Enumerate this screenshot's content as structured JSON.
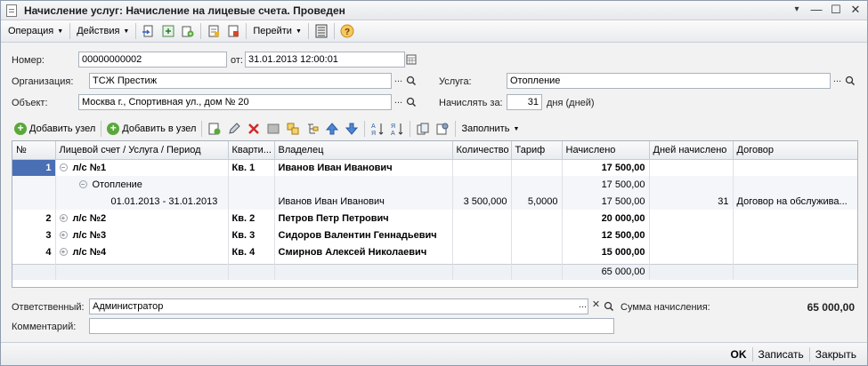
{
  "window": {
    "title": "Начисление услуг: Начисление на лицевые счета. Проведен",
    "menu_glyph": "▾",
    "min_glyph": "—",
    "max_glyph": "☐",
    "close_glyph": "✕"
  },
  "commandbar": {
    "operation": "Операция",
    "actions": "Действия",
    "goto": "Перейти"
  },
  "form": {
    "number_label": "Номер:",
    "number_value": "00000000002",
    "from_label": "от:",
    "date_value": "31.01.2013 12:00:01",
    "org_label": "Организация:",
    "org_value": "ТСЖ Престиж",
    "object_label": "Объект:",
    "object_value": "Москва г., Спортивная ул., дом № 20",
    "service_label": "Услуга:",
    "service_value": "Отопление",
    "accrue_label": "Начислять за:",
    "accrue_days": "31",
    "accrue_unit": "дня (дней)",
    "ellipsis": "...",
    "clear": "✕"
  },
  "table_toolbar": {
    "add_node": "Добавить узел",
    "add_in_node": "Добавить в узел",
    "fill": "Заполнить"
  },
  "grid": {
    "columns": [
      "№",
      "Лицевой счет / Услуга / Период",
      "Кварти...",
      "Владелец",
      "Количество",
      "Тариф",
      "Начислено",
      "Дней начислено",
      "Договор"
    ],
    "rows": [
      {
        "n": "1",
        "account": "л/с №1",
        "apt": "Кв. 1",
        "owner": "Иванов Иван Иванович",
        "qty": "",
        "tariff": "",
        "accrued": "17 500,00",
        "days": "",
        "contract": ""
      },
      {
        "n": "",
        "account": "Отопление",
        "apt": "",
        "owner": "",
        "qty": "",
        "tariff": "",
        "accrued": "17 500,00",
        "days": "",
        "contract": ""
      },
      {
        "n": "",
        "account": "01.01.2013 - 31.01.2013",
        "apt": "",
        "owner": "Иванов Иван Иванович",
        "qty": "3 500,000",
        "tariff": "5,0000",
        "accrued": "17 500,00",
        "days": "31",
        "contract": "Договор на обслужива..."
      },
      {
        "n": "2",
        "account": "л/с №2",
        "apt": "Кв. 2",
        "owner": "Петров Петр Петрович",
        "qty": "",
        "tariff": "",
        "accrued": "20 000,00",
        "days": "",
        "contract": ""
      },
      {
        "n": "3",
        "account": "л/с №3",
        "apt": "Кв. 3",
        "owner": "Сидоров Валентин Геннадьевич",
        "qty": "",
        "tariff": "",
        "accrued": "12 500,00",
        "days": "",
        "contract": ""
      },
      {
        "n": "4",
        "account": "л/с №4",
        "apt": "Кв. 4",
        "owner": "Смирнов Алексей Николаевич",
        "qty": "",
        "tariff": "",
        "accrued": "15 000,00",
        "days": "",
        "contract": ""
      }
    ],
    "total": "65 000,00"
  },
  "footer": {
    "responsible_label": "Ответственный:",
    "responsible_value": "Администратор",
    "sum_label": "Сумма начисления:",
    "sum_value": "65 000,00",
    "comment_label": "Комментарий:",
    "comment_value": ""
  },
  "buttons": {
    "ok": "OK",
    "save": "Записать",
    "close": "Закрыть"
  }
}
